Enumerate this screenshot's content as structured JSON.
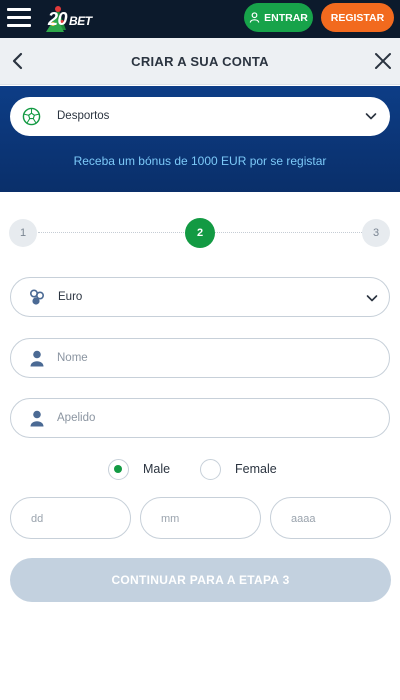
{
  "nav": {
    "logo_text": "20",
    "logo_suffix": "BET",
    "login_label": "ENTRAR",
    "register_label": "REGISTAR"
  },
  "header": {
    "title": "CRIAR A SUA CONTA"
  },
  "banner": {
    "sport_selected": "Desportos",
    "bonus_text": "Receba um bónus de 1000 EUR por se registar"
  },
  "stepper": {
    "steps": [
      "1",
      "2",
      "3"
    ],
    "current": 2
  },
  "form": {
    "currency_value": "Euro",
    "first_name_placeholder": "Nome",
    "last_name_placeholder": "Apelido",
    "gender_male": "Male",
    "gender_female": "Female",
    "gender_selected": "Male",
    "dob_day_placeholder": "dd",
    "dob_month_placeholder": "mm",
    "dob_year_placeholder": "aaaa",
    "continue_label": "CONTINUAR PARA A ETAPA 3"
  },
  "colors": {
    "nav_bg": "#0c1a2c",
    "login_green": "#17a34a",
    "register_orange": "#f26a1e",
    "banner_blue": "#0d3d86",
    "bonus_text": "#7cc9f8",
    "active_step": "#139a43",
    "continue_disabled": "#c3d1df"
  },
  "icons": {
    "menu": "hamburger-icon",
    "login": "user-icon",
    "back": "chevron-left-icon",
    "close": "close-icon",
    "sport": "soccer-ball-icon",
    "currency": "coins-icon",
    "person": "person-icon",
    "dropdown": "chevron-down-icon"
  }
}
